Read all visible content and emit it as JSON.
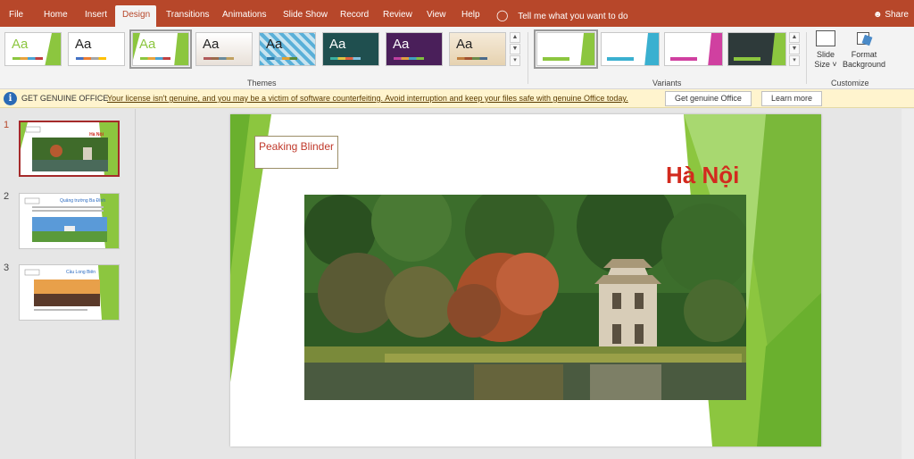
{
  "tabs": [
    "File",
    "Home",
    "Insert",
    "Design",
    "Transitions",
    "Animations",
    "Slide Show",
    "Record",
    "Review",
    "View",
    "Help"
  ],
  "active_tab": "Design",
  "tell_me": "Tell me what you want to do",
  "share_label": "Share",
  "themes": {
    "sample_text": "Aa",
    "group_label": "Themes"
  },
  "variants": {
    "group_label": "Variants"
  },
  "customize": {
    "slide_size_line1": "Slide",
    "slide_size_line2": "Size",
    "format_bg_line1": "Format",
    "format_bg_line2": "Background",
    "group_label": "Customize"
  },
  "infobar": {
    "title": "GET GENUINE OFFICE",
    "message": "Your license isn't genuine, and you may be a victim of software counterfeiting. Avoid interruption and keep your files safe with genuine Office today.",
    "get_button": "Get genuine Office",
    "learn_button": "Learn more"
  },
  "thumbnails": [
    {
      "number": "1",
      "title": "Hà Nội"
    },
    {
      "number": "2",
      "title": "Quảng trường Ba Đình"
    },
    {
      "number": "3",
      "title": "Cầu Long Biên"
    }
  ],
  "slide": {
    "textbox": "Peaking Blinder",
    "title": "Hà Nội"
  },
  "colors": {
    "accent": "#b7472a",
    "title_red": "#d22a1e",
    "green": "#8cc63f"
  }
}
